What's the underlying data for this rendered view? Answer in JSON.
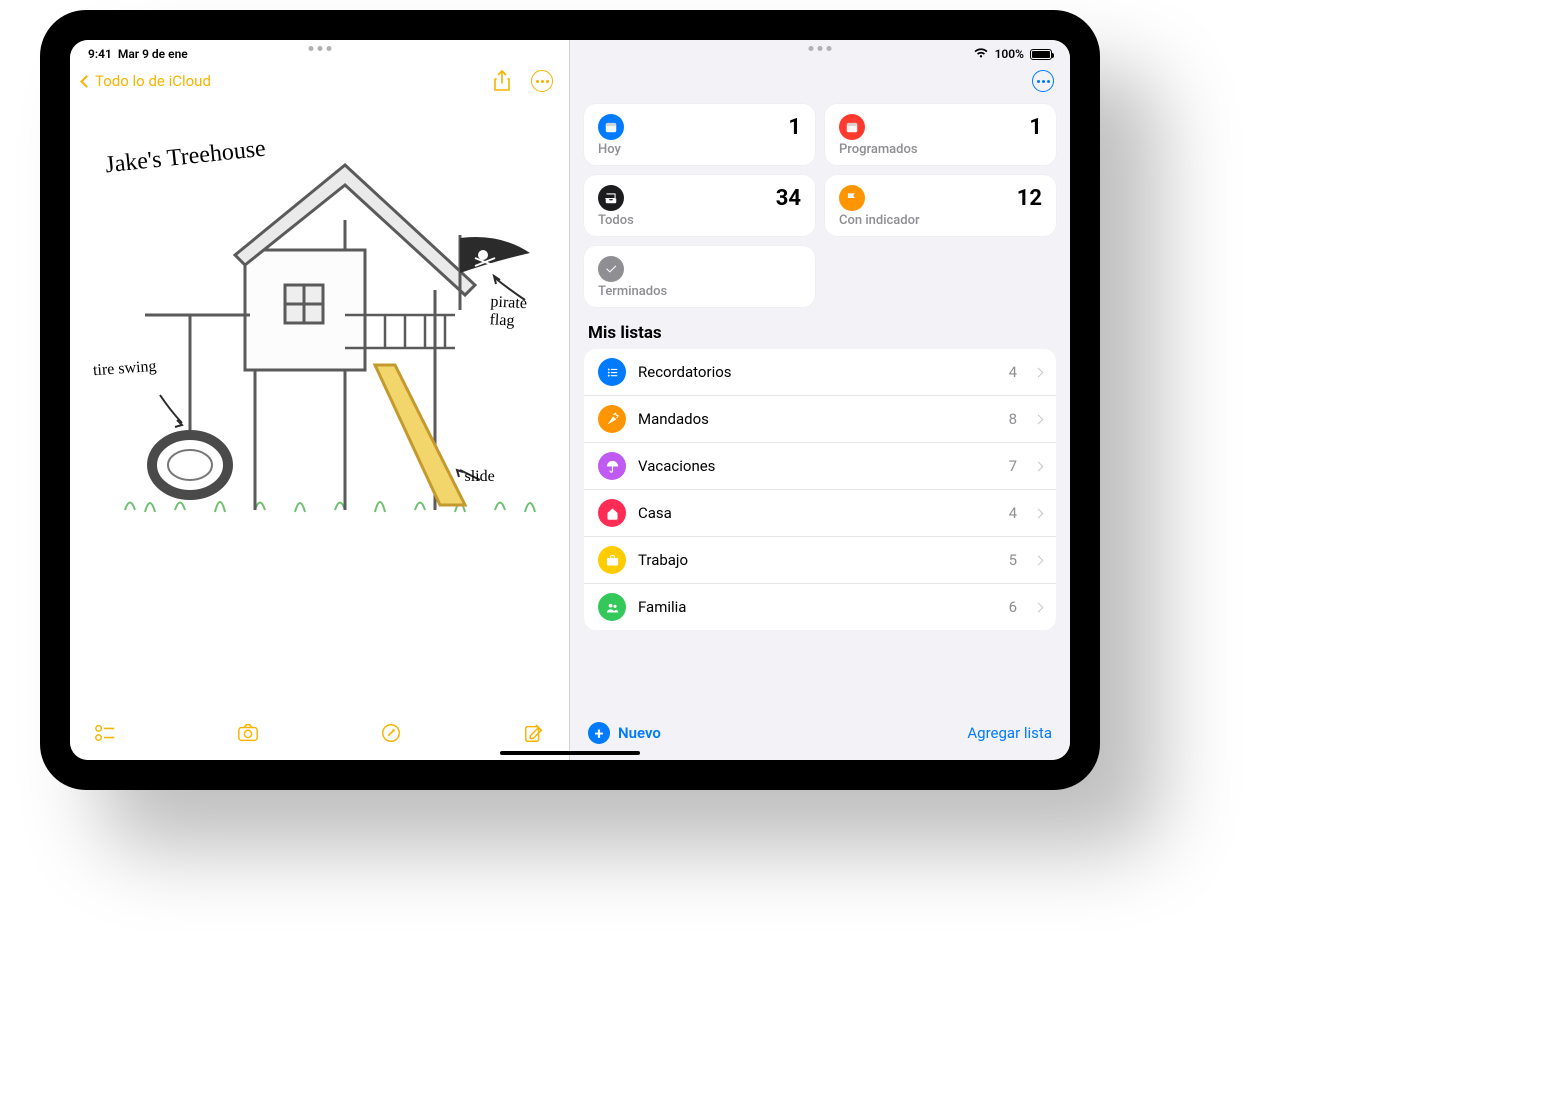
{
  "status": {
    "time": "9:41",
    "date": "Mar 9 de ene",
    "battery_pct": "100%"
  },
  "notes": {
    "back_label": "Todo lo de iCloud",
    "title_line1": "",
    "title_line2": "",
    "sketch": {
      "title": "Jake's Treehouse",
      "label_tire": "tire swing",
      "label_flag": "pirate flag",
      "label_slide": "slide"
    }
  },
  "reminders": {
    "smart": [
      {
        "label": "Hoy",
        "count": "1",
        "color": "bg-blue",
        "icon": "calendar"
      },
      {
        "label": "Programados",
        "count": "1",
        "color": "bg-red",
        "icon": "calendar"
      },
      {
        "label": "Todos",
        "count": "34",
        "color": "bg-dark",
        "icon": "tray"
      },
      {
        "label": "Con indicador",
        "count": "12",
        "color": "bg-orange",
        "icon": "flag"
      },
      {
        "label": "Terminados",
        "count": "",
        "color": "bg-gray",
        "icon": "check"
      }
    ],
    "section_title": "Mis listas",
    "lists": [
      {
        "name": "Recordatorios",
        "count": "4",
        "color": "bg-blue",
        "icon": "list"
      },
      {
        "name": "Mandados",
        "count": "8",
        "color": "bg-orange",
        "icon": "carrot"
      },
      {
        "name": "Vacaciones",
        "count": "7",
        "color": "bg-purple",
        "icon": "umbrella"
      },
      {
        "name": "Casa",
        "count": "4",
        "color": "bg-pink",
        "icon": "home"
      },
      {
        "name": "Trabajo",
        "count": "5",
        "color": "bg-yellow",
        "icon": "briefcase"
      },
      {
        "name": "Familia",
        "count": "6",
        "color": "bg-green",
        "icon": "people"
      }
    ],
    "new_label": "Nuevo",
    "add_list_label": "Agregar lista"
  }
}
